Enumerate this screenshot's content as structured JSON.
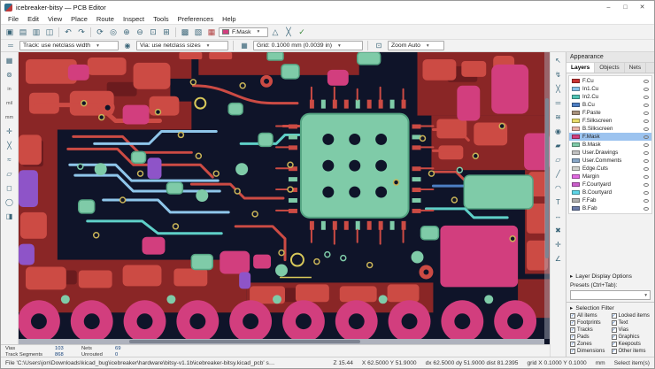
{
  "window": {
    "title": "icebreaker-bitsy — PCB Editor",
    "minimize": "–",
    "maximize": "□",
    "close": "✕"
  },
  "menu": {
    "items": [
      "File",
      "Edit",
      "View",
      "Place",
      "Route",
      "Inspect",
      "Tools",
      "Preferences",
      "Help"
    ]
  },
  "toolbar_top": {
    "icons": [
      {
        "name": "save",
        "glyph": "▣"
      },
      {
        "name": "page-settings",
        "glyph": "▤"
      },
      {
        "name": "print",
        "glyph": "▥"
      },
      {
        "name": "plot",
        "glyph": "◫"
      },
      {
        "name": "undo",
        "glyph": "↶"
      },
      {
        "name": "redo",
        "glyph": "↷"
      },
      {
        "name": "refresh",
        "glyph": "⟳"
      },
      {
        "name": "find",
        "glyph": "◎"
      },
      {
        "name": "zoom-in",
        "glyph": "⊕"
      },
      {
        "name": "zoom-out",
        "glyph": "⊖"
      },
      {
        "name": "zoom-fit",
        "glyph": "⊡"
      },
      {
        "name": "zoom-selection",
        "glyph": "⊞"
      },
      {
        "name": "footprint-editor",
        "glyph": "▩"
      },
      {
        "name": "3d-viewer",
        "glyph": "▧"
      },
      {
        "name": "layer-manager",
        "glyph": "▦"
      },
      {
        "name": "highlight-net",
        "glyph": "△"
      },
      {
        "name": "show-ratsnest",
        "glyph": "╳"
      },
      {
        "name": "drc",
        "glyph": "✓"
      }
    ],
    "active_layer": "F.Mask"
  },
  "toolbar_second": {
    "track": "Track: use netclass width",
    "via": "Via: use netclass sizes",
    "grid": "Grid: 0.1000 mm (0.0039 in)",
    "zoom": "Zoom Auto"
  },
  "left_toolbar": {
    "icons": [
      {
        "name": "grid-toggle",
        "glyph": "▦"
      },
      {
        "name": "polar-coords",
        "glyph": "⊚"
      },
      {
        "name": "units-inches",
        "glyph": "in"
      },
      {
        "name": "units-mils",
        "glyph": "mil"
      },
      {
        "name": "units-mm",
        "glyph": "mm"
      },
      {
        "name": "crosshair-cursor",
        "glyph": "✛"
      },
      {
        "name": "ratsnest-toggle",
        "glyph": "╳"
      },
      {
        "name": "curved-ratsnest",
        "glyph": "≈"
      },
      {
        "name": "zone-display-mode",
        "glyph": "▱"
      },
      {
        "name": "pad-display-mode",
        "glyph": "◻"
      },
      {
        "name": "via-display-mode",
        "glyph": "◯"
      },
      {
        "name": "appearance-toggle",
        "glyph": "◨"
      }
    ]
  },
  "right_toolbar": {
    "icons": [
      {
        "name": "select-tool",
        "glyph": "↖"
      },
      {
        "name": "highlight-net-tool",
        "glyph": "↯"
      },
      {
        "name": "local-ratsnest",
        "glyph": "╳"
      },
      {
        "name": "route-tracks",
        "glyph": "═"
      },
      {
        "name": "route-diff-pair",
        "glyph": "≋"
      },
      {
        "name": "place-via",
        "glyph": "◉"
      },
      {
        "name": "add-zone",
        "glyph": "▰"
      },
      {
        "name": "rule-area",
        "glyph": "▱"
      },
      {
        "name": "draw-line",
        "glyph": "╱"
      },
      {
        "name": "draw-arc",
        "glyph": "◠"
      },
      {
        "name": "add-text",
        "glyph": "T"
      },
      {
        "name": "add-dimension",
        "glyph": "↔"
      },
      {
        "name": "delete-tool",
        "glyph": "✖"
      },
      {
        "name": "drill-origin",
        "glyph": "✛"
      },
      {
        "name": "measure-tool",
        "glyph": "∠"
      }
    ]
  },
  "appearance": {
    "title": "Appearance",
    "tabs": [
      {
        "label": "Layers",
        "active": true
      },
      {
        "label": "Objects",
        "active": false
      },
      {
        "label": "Nets",
        "active": false
      }
    ],
    "layers": [
      {
        "name": "F.Cu",
        "color": "#C83434"
      },
      {
        "name": "In1.Cu",
        "color": "#89C3E8"
      },
      {
        "name": "In2.Cu",
        "color": "#4FC3B4"
      },
      {
        "name": "B.Cu",
        "color": "#4D7FC4"
      },
      {
        "name": "F.Paste",
        "color": "#A8927D"
      },
      {
        "name": "F.Silkscreen",
        "color": "#E8DB6A"
      },
      {
        "name": "B.Silkscreen",
        "color": "#E8B2A7"
      },
      {
        "name": "F.Mask",
        "color": "#D23E7E"
      },
      {
        "name": "B.Mask",
        "color": "#7FCBA8"
      },
      {
        "name": "User.Drawings",
        "color": "#C2C2C2"
      },
      {
        "name": "User.Comments",
        "color": "#89A8C8"
      },
      {
        "name": "Edge.Cuts",
        "color": "#D0D2CD"
      },
      {
        "name": "Margin",
        "color": "#E26AE2"
      },
      {
        "name": "F.Courtyard",
        "color": "#CC5ECC"
      },
      {
        "name": "B.Courtyard",
        "color": "#5FD7E8"
      },
      {
        "name": "F.Fab",
        "color": "#AFAFAF"
      },
      {
        "name": "B.Fab",
        "color": "#6A7BA8"
      }
    ],
    "active_layer_index": 7,
    "layer_display_options": "Layer Display Options",
    "presets_label": "Presets (Ctrl+Tab):",
    "presets_value": ""
  },
  "selection_filter": {
    "title": "Selection Filter",
    "items": [
      {
        "label": "All items",
        "checked": true
      },
      {
        "label": "Locked items",
        "checked": true
      },
      {
        "label": "Footprints",
        "checked": true
      },
      {
        "label": "Text",
        "checked": true
      },
      {
        "label": "Tracks",
        "checked": true
      },
      {
        "label": "Vias",
        "checked": true
      },
      {
        "label": "Pads",
        "checked": true
      },
      {
        "label": "Graphics",
        "checked": true
      },
      {
        "label": "Zones",
        "checked": true
      },
      {
        "label": "Keepouts",
        "checked": true
      },
      {
        "label": "Dimensions",
        "checked": true
      },
      {
        "label": "Other items",
        "checked": true
      }
    ]
  },
  "message_panel": {
    "pairs": [
      {
        "label": "Vias",
        "value": "103"
      },
      {
        "label": "Track Segments",
        "value": "868"
      },
      {
        "label": "Nets",
        "value": "69"
      },
      {
        "label": "Unrouted",
        "value": "0"
      }
    ]
  },
  "status_bar": {
    "file_message": "File 'C:\\Users\\jon\\Downloads\\kicad_bug\\icebreaker\\hardware\\bitsy-v1.1b\\icebreaker-bitsy.kicad_pcb' saved.",
    "zoom": "Z 15.44",
    "position": "X 62.5000  Y 51.9000",
    "delta": "dx 62.5000  dy 51.9000  dist 81.2395",
    "grid": "grid X 0.1000  Y 0.1000",
    "units": "mm",
    "hint": "Select item(s)"
  },
  "glyphs": {
    "dropdown": "▾",
    "check": "✓",
    "collapse": "▸"
  },
  "canvas": {
    "palette": {
      "bg": "#0F1429",
      "zone": "#8A2626",
      "zone2": "#6B1B1E",
      "fcu": "#CC4B44",
      "pink": "#D23E7E",
      "mint": "#7FCBA8",
      "mint2": "#55A583",
      "blue2": "#8FC6EA",
      "aqua": "#5FD0C8",
      "bcu": "#4D7FC4",
      "purple": "#8E54C8",
      "gold": "#C9B458",
      "silk": "#D8C85A"
    }
  }
}
